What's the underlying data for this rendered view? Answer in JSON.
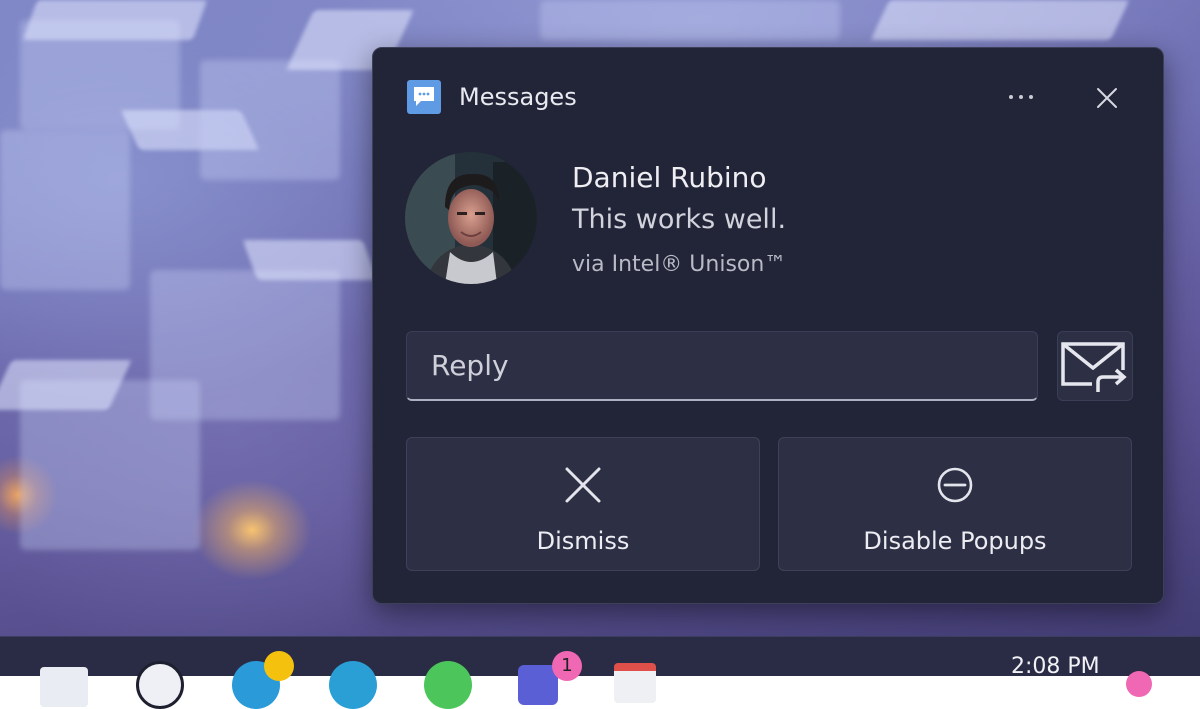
{
  "notification": {
    "app_name": "Messages",
    "sender": "Daniel Rubino",
    "message": "This works well.",
    "attribution": "via Intel® Unison™",
    "reply_placeholder": "Reply",
    "actions": {
      "dismiss_label": "Dismiss",
      "disable_label": "Disable Popups"
    },
    "icons": {
      "app": "messages-icon",
      "more": "more-options-icon",
      "close": "close-icon",
      "send": "send-reply-icon",
      "dismiss": "dismiss-icon",
      "disable": "disable-popups-icon"
    }
  },
  "taskbar": {
    "time": "2:08 PM",
    "badge_count": "1"
  },
  "colors": {
    "accent_blue": "#5e9be4",
    "toast_bg": "#222538",
    "button_bg": "#2d3045",
    "badge_yellow": "#f4c10f",
    "badge_pink": "#f067b4"
  }
}
